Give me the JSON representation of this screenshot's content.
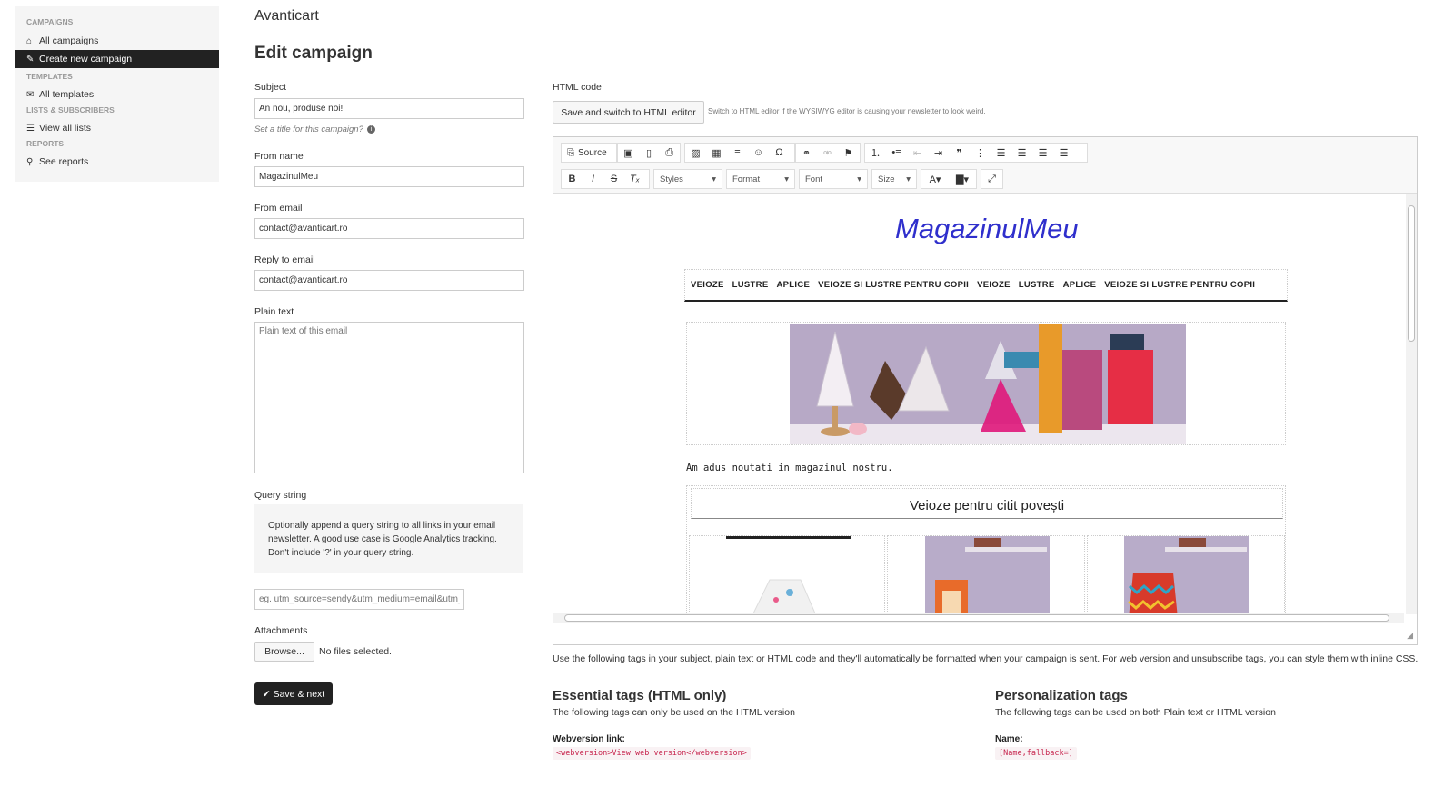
{
  "sidebar": {
    "campaigns_head": "CAMPAIGNS",
    "all_campaigns": "All campaigns",
    "create_new": "Create new campaign",
    "templates_head": "TEMPLATES",
    "all_templates": "All templates",
    "lists_head": "LISTS & SUBSCRIBERS",
    "view_lists": "View all lists",
    "reports_head": "REPORTS",
    "see_reports": "See reports"
  },
  "header": {
    "brand": "Avanticart",
    "title": "Edit campaign"
  },
  "form": {
    "subject_label": "Subject",
    "subject_value": "An nou, produse noi!",
    "subject_help": "Set a title for this campaign?",
    "from_name_label": "From name",
    "from_name_value": "MagazinulMeu",
    "from_email_label": "From email",
    "from_email_value": "contact@avanticart.ro",
    "reply_label": "Reply to email",
    "reply_value": "contact@avanticart.ro",
    "plain_label": "Plain text",
    "plain_placeholder": "Plain text of this email",
    "query_label": "Query string",
    "query_info": "Optionally append a query string to all links in your email newsletter. A good use case is Google Analytics tracking. Don't include '?' in your query string.",
    "query_placeholder": "eg. utm_source=sendy&utm_medium=email&utm_campaign=",
    "attach_label": "Attachments",
    "browse": "Browse...",
    "no_files": "No files selected.",
    "save_next": "Save & next"
  },
  "editor": {
    "html_label": "HTML code",
    "switch_btn": "Save and switch to HTML editor",
    "switch_help": "Switch to HTML editor if the WYSIWYG editor is causing your newsletter to look weird.",
    "source": "Source",
    "styles": "Styles",
    "format": "Format",
    "font": "Font",
    "size": "Size"
  },
  "newsletter": {
    "logo": "MagazinulMeu",
    "nav": [
      "VEIOZE",
      "LUSTRE",
      "APLICE",
      "VEIOZE SI LUSTRE PENTRU COPII",
      "VEIOZE",
      "LUSTRE",
      "APLICE",
      "VEIOZE SI LUSTRE PENTRU COPII"
    ],
    "intro": "Am adus noutati in magazinul nostru.",
    "section_title": "Veioze pentru citit povești"
  },
  "tags": {
    "info": "Use the following tags in your subject, plain text or HTML code and they'll automatically be formatted when your campaign is sent. For web version and unsubscribe tags, you can style them with inline CSS.",
    "essential_title": "Essential tags (HTML only)",
    "essential_sub": "The following tags can only be used on the HTML version",
    "webversion_label": "Webversion link:",
    "webversion_code": "<webversion>View web version</webversion>",
    "personal_title": "Personalization tags",
    "personal_sub": "The following tags can be used on both Plain text or HTML version",
    "name_label": "Name:",
    "name_code": "[Name,fallback=]"
  },
  "colors": {
    "accent": "#222222",
    "logo": "#2f2fcc",
    "code": "#c7254e"
  }
}
